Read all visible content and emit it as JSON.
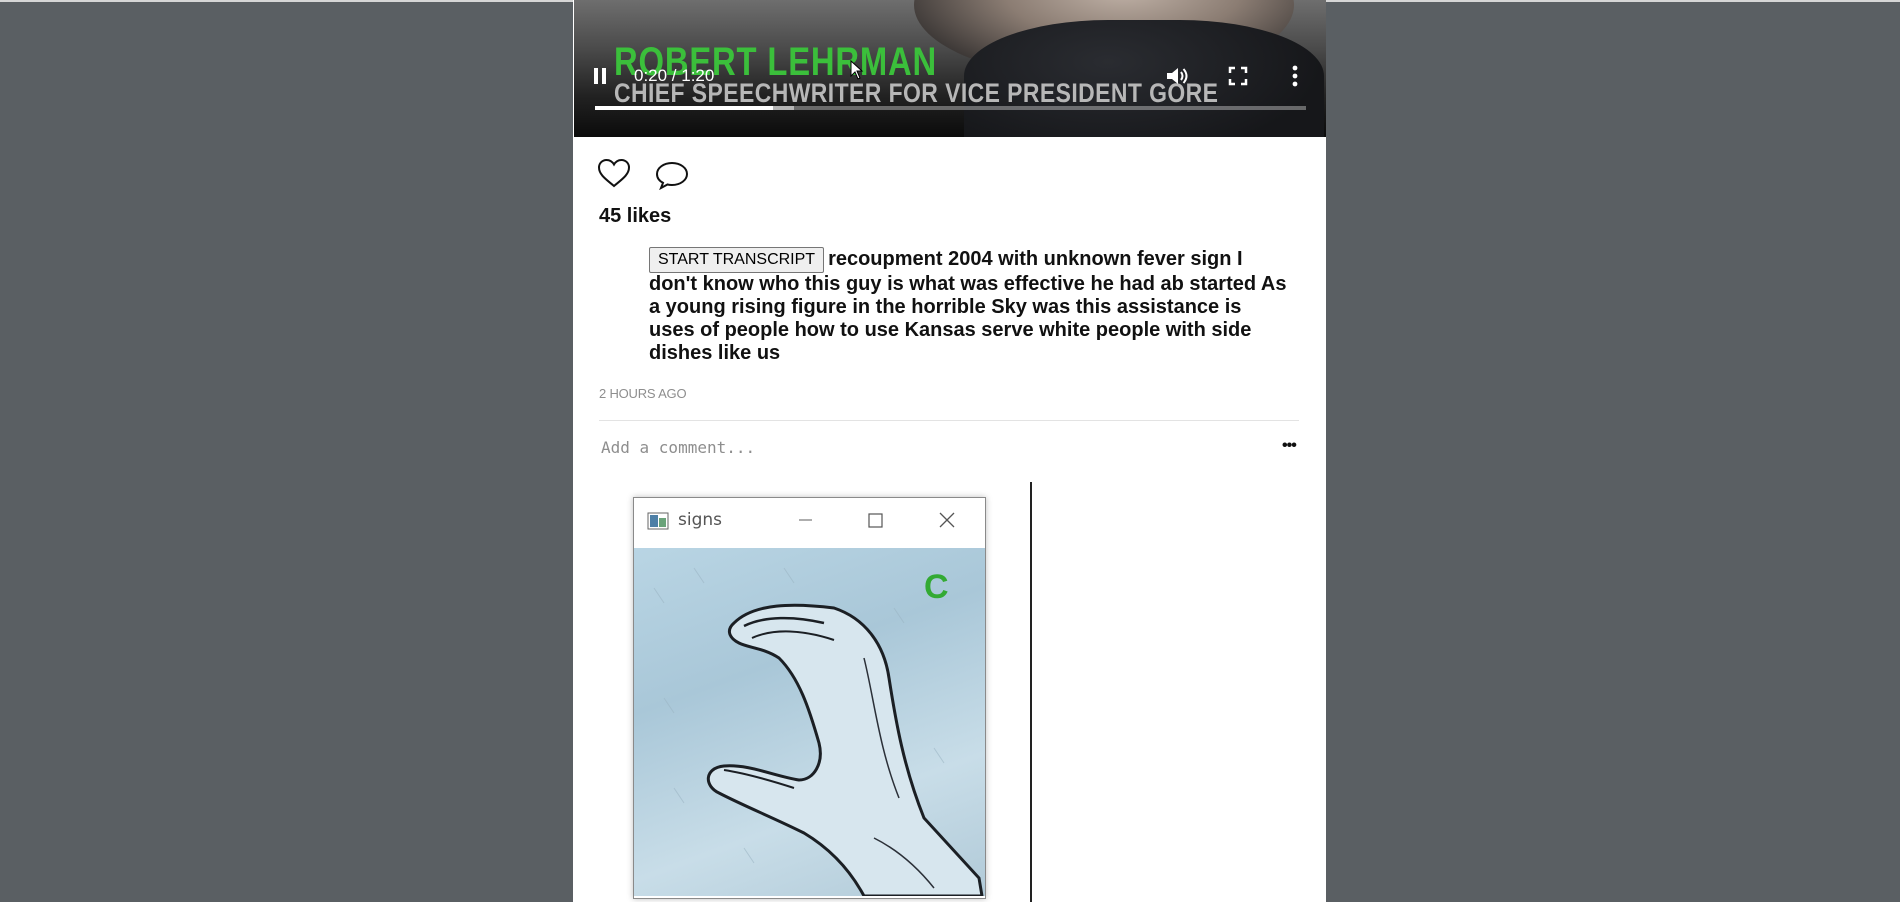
{
  "video": {
    "lower_third_name": "ROBERT LEHRMAN",
    "lower_third_title": "CHIEF SPEECHWRITER FOR VICE PRESIDENT GORE",
    "time_display": "0:20 / 1:20",
    "progress_fraction": 0.25,
    "buffered_fraction": 0.28
  },
  "post": {
    "likes": "45 likes",
    "transcript_button": "START TRANSCRIPT",
    "caption": "recoupment 2004 with unknown fever sign I don't know who this guy is what was effective he had ab started As a young rising figure in the horrible Sky was this assistance is uses of people how to use Kansas serve white people with side dishes like us",
    "time_ago": "2 HOURS AGO",
    "comment_placeholder": "Add a comment...",
    "more_label": "•••"
  },
  "signs_window": {
    "title": "signs",
    "detected_letter": "C"
  },
  "colors": {
    "page_background": "#5a5f63",
    "lower_third_name": "#3bbf3b",
    "detected_letter": "#33aa33"
  },
  "icons": [
    "pause-icon",
    "volume-icon",
    "fullscreen-icon",
    "more-vert-icon",
    "heart-icon",
    "comment-icon",
    "minimize-icon",
    "maximize-icon",
    "close-icon"
  ]
}
